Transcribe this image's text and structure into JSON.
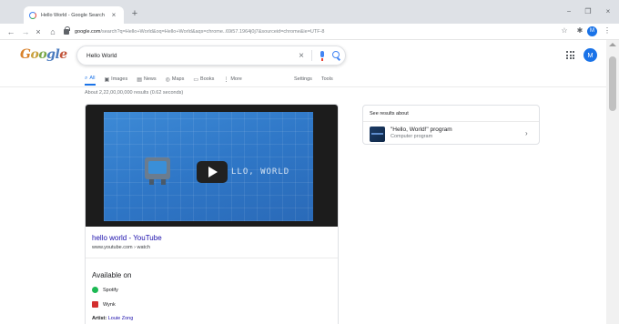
{
  "browser": {
    "tab_title": "Hello World - Google Search",
    "tab_close": "×",
    "new_tab": "+",
    "url_host": "google.com",
    "url_rest": "/search?q=Hello+World&oq=Hello+World&aqs=chrome..69i57.1964j0j7&sourceid=chrome&ie=UTF-8",
    "nav": {
      "back": "←",
      "forward": "→",
      "reload": "×",
      "home": "⌂"
    },
    "window": {
      "minimize": "−",
      "maximize": "❐",
      "close": "×"
    },
    "toolbar": {
      "star": "☆",
      "extension": "✱",
      "avatar_letter": "M",
      "menu": "⋮"
    }
  },
  "google": {
    "logo": {
      "g1": "G",
      "o1": "o",
      "o2": "o",
      "gl": "gl",
      "e": "e"
    },
    "query": "Hello World",
    "clear": "×",
    "account_letter": "M",
    "tabs": [
      {
        "icon": "⌕",
        "label": "All"
      },
      {
        "icon": "▣",
        "label": "Images"
      },
      {
        "icon": "▤",
        "label": "News"
      },
      {
        "icon": "◎",
        "label": "Maps"
      },
      {
        "icon": "▭",
        "label": "Books"
      },
      {
        "icon": "⋮",
        "label": "More"
      }
    ],
    "settings_label": "Settings",
    "tools_label": "Tools",
    "stats": "About 2,22,00,00,000 results (0.62 seconds)",
    "video": {
      "overlay_text": "LLO, WORLD",
      "title": "hello world - YouTube",
      "url": "www.youtube.com › watch"
    },
    "available_on": {
      "title": "Available on",
      "providers": [
        "Spotify",
        "Wynk"
      ],
      "artist_label": "Artist:",
      "artist_name": "Louie Zong"
    },
    "see_results": {
      "heading": "See results about",
      "entity_name": "\"Hello, World!\" program",
      "entity_sub": "Computer program",
      "chevron": "›"
    }
  }
}
